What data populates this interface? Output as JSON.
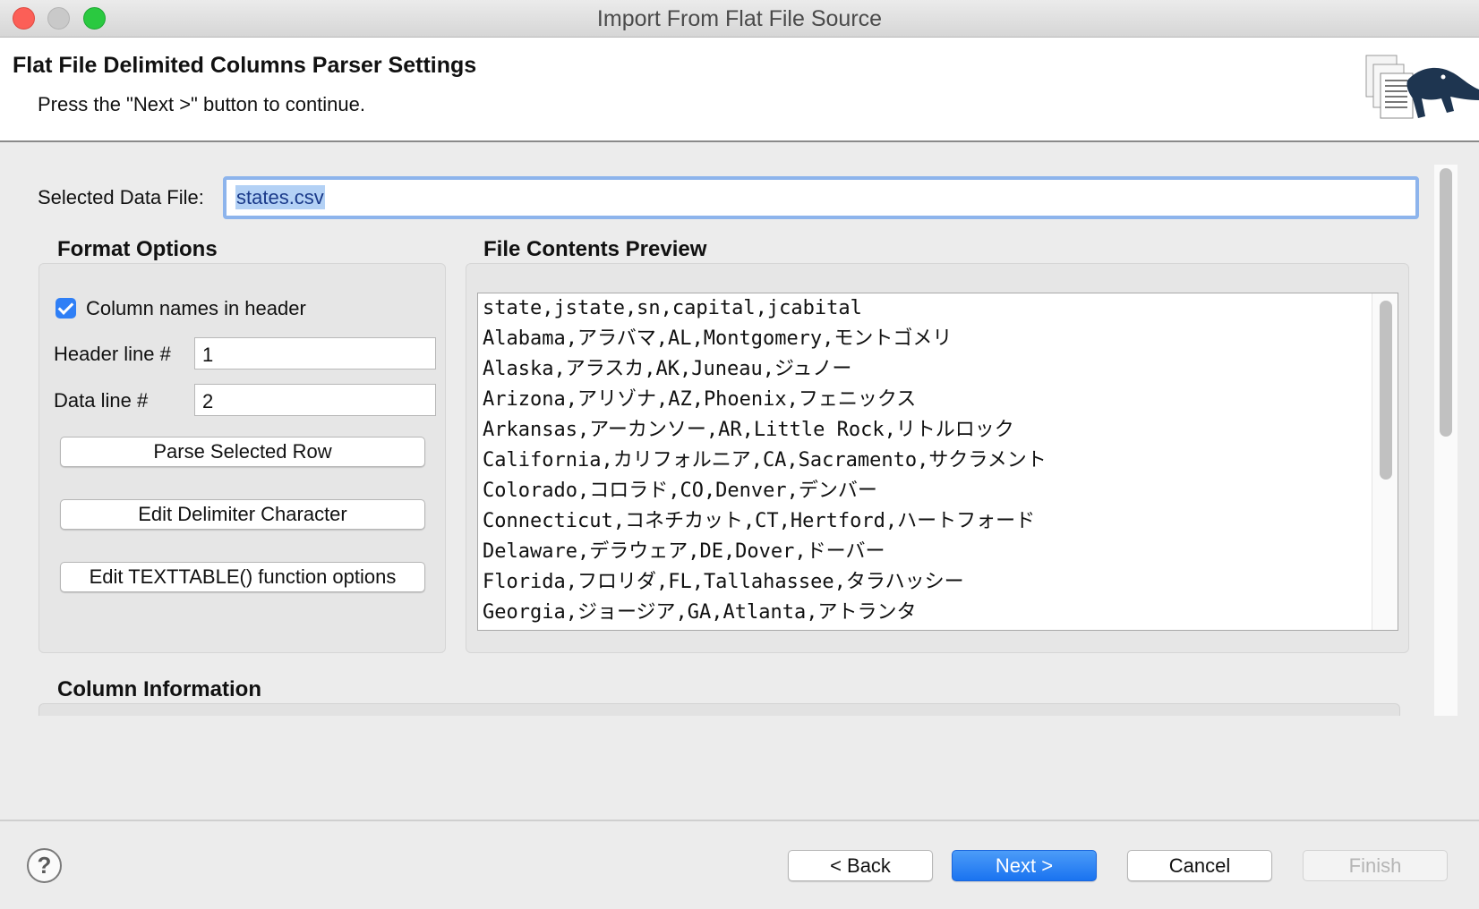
{
  "window": {
    "title": "Import From Flat File Source"
  },
  "banner": {
    "title": "Flat File Delimited Columns Parser Settings",
    "subtitle": "Press the \"Next >\" button to continue."
  },
  "file": {
    "label": "Selected Data File:",
    "value": "states.csv"
  },
  "format_options": {
    "title": "Format Options",
    "column_names_in_header": {
      "label": "Column names in header",
      "checked": true
    },
    "header_line": {
      "label": "Header line #",
      "value": "1"
    },
    "data_line": {
      "label": "Data line #",
      "value": "2"
    },
    "buttons": {
      "parse": "Parse Selected Row",
      "edit_delimiter": "Edit Delimiter Character",
      "edit_texttable": "Edit TEXTTABLE() function options"
    }
  },
  "preview": {
    "title": "File Contents Preview",
    "lines": [
      "state,jstate,sn,capital,jcabital",
      "Alabama,アラバマ,AL,Montgomery,モントゴメリ",
      "Alaska,アラスカ,AK,Juneau,ジュノー",
      "Arizona,アリゾナ,AZ,Phoenix,フェニックス",
      "Arkansas,アーカンソー,AR,Little Rock,リトルロック",
      "California,カリフォルニア,CA,Sacramento,サクラメント",
      "Colorado,コロラド,CO,Denver,デンバー",
      "Connecticut,コネチカット,CT,Hertford,ハートフォード",
      "Delaware,デラウェア,DE,Dover,ドーバー",
      "Florida,フロリダ,FL,Tallahassee,タラハッシー",
      "Georgia,ジョージア,GA,Atlanta,アトランタ"
    ]
  },
  "column_info": {
    "title": "Column Information"
  },
  "footer": {
    "help": "?",
    "back": "< Back",
    "next": "Next >",
    "cancel": "Cancel",
    "finish": "Finish"
  }
}
